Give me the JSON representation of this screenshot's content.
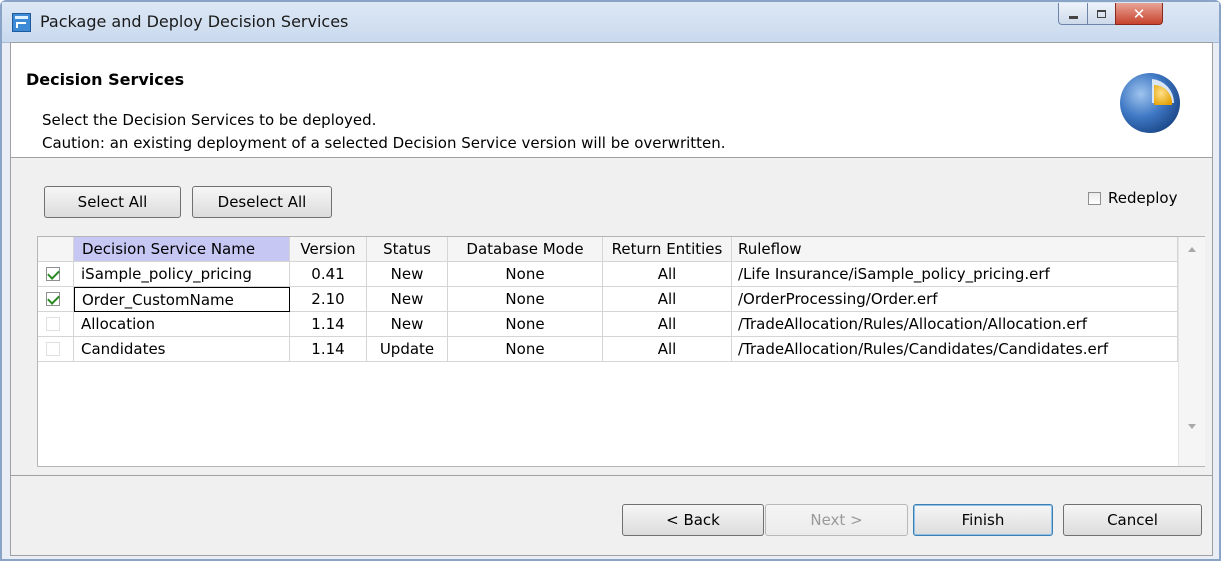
{
  "window": {
    "title": "Package and Deploy Decision Services"
  },
  "header": {
    "title": "Decision Services",
    "message1": "Select the Decision Services to be deployed.",
    "message2": "Caution: an existing deployment of a selected Decision Service version will be overwritten."
  },
  "toolbar": {
    "select_all": "Select All",
    "deselect_all": "Deselect All",
    "redeploy_label": "Redeploy",
    "redeploy_checked": false
  },
  "table": {
    "columns": [
      "Decision Service Name",
      "Version",
      "Status",
      "Database Mode",
      "Return Entities",
      "Ruleflow"
    ],
    "rows": [
      {
        "checked": true,
        "name": "iSample_policy_pricing",
        "version": "0.41",
        "status": "New",
        "db_mode": "None",
        "return_entities": "All",
        "ruleflow": "/Life Insurance/iSample_policy_pricing.erf"
      },
      {
        "checked": true,
        "name": "Order_CustomName",
        "version": "2.10",
        "status": "New",
        "db_mode": "None",
        "return_entities": "All",
        "ruleflow": "/OrderProcessing/Order.erf"
      },
      {
        "checked": false,
        "name": "Allocation",
        "version": "1.14",
        "status": "New",
        "db_mode": "None",
        "return_entities": "All",
        "ruleflow": "/TradeAllocation/Rules/Allocation/Allocation.erf"
      },
      {
        "checked": false,
        "name": "Candidates",
        "version": "1.14",
        "status": "Update",
        "db_mode": "None",
        "return_entities": "All",
        "ruleflow": "/TradeAllocation/Rules/Candidates/Candidates.erf"
      }
    ]
  },
  "footer": {
    "back": "< Back",
    "next": "Next >",
    "finish": "Finish",
    "cancel": "Cancel"
  }
}
